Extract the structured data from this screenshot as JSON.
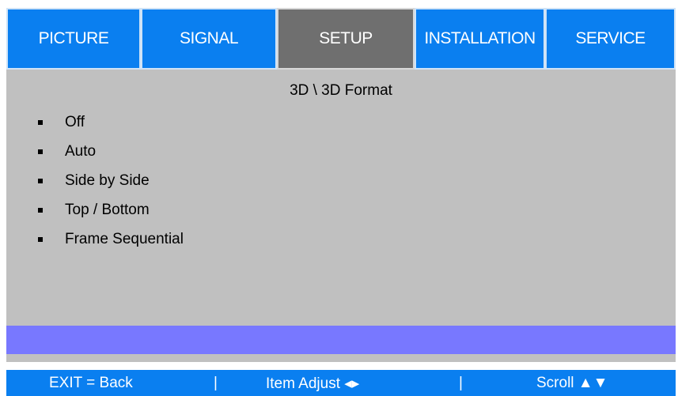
{
  "tabs": [
    {
      "label": "PICTURE"
    },
    {
      "label": "SIGNAL"
    },
    {
      "label": "SETUP"
    },
    {
      "label": "INSTALLATION"
    },
    {
      "label": "SERVICE"
    }
  ],
  "active_tab": "SETUP",
  "panel": {
    "heading": "3D \\ 3D Format",
    "options": [
      "Off",
      "Auto",
      "Side by Side",
      "Top / Bottom",
      "Frame Sequential"
    ]
  },
  "footer": {
    "exit": "EXIT = Back",
    "separator": "|",
    "item_adjust": "Item Adjust ◂▸",
    "scroll": "Scroll ▲▼"
  },
  "colors": {
    "tab_blue": "#0a7ff0",
    "tab_active": "#6f6f6f",
    "panel_gray": "#c0c0c0",
    "highlight": "#7878ff"
  }
}
